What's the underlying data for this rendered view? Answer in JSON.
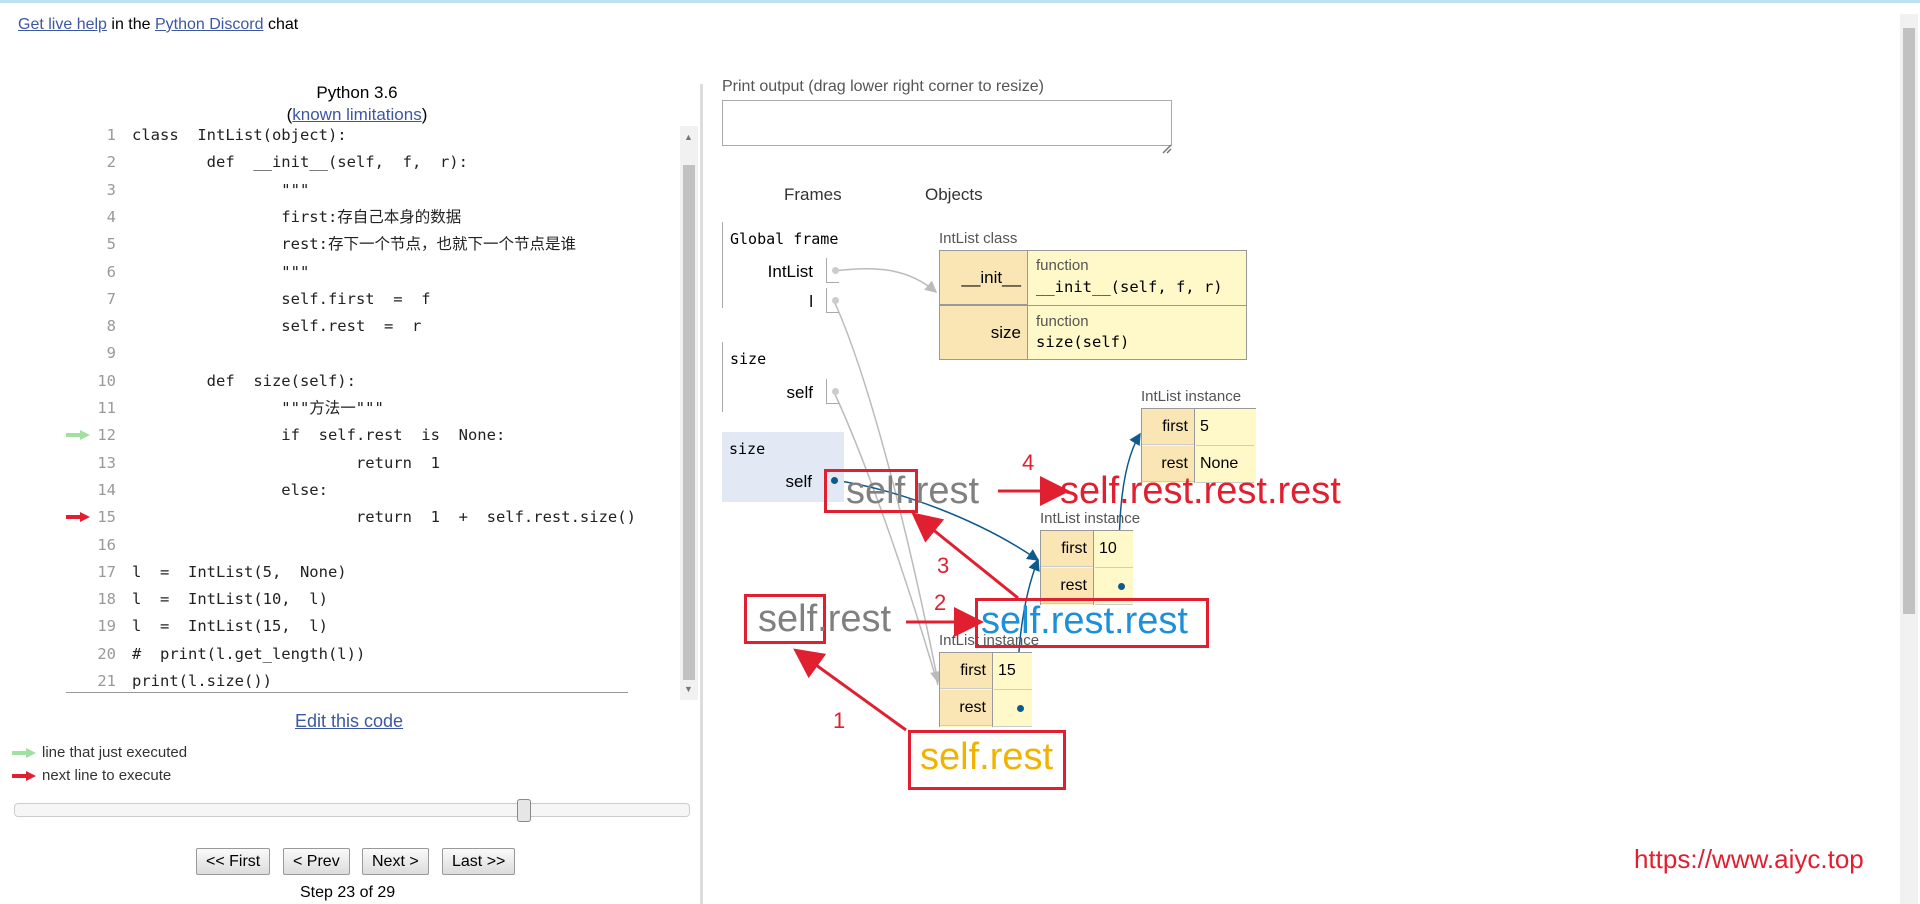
{
  "header": {
    "live_help_link": "Get live help",
    "in_the": "in the",
    "discord_link": "Python Discord",
    "chat": "chat"
  },
  "code": {
    "language": "Python 3.6",
    "limitations_link": "known limitations",
    "lines": [
      {
        "n": "1",
        "text": "class  IntList(object):"
      },
      {
        "n": "2",
        "text": "        def  __init__(self,  f,  r):"
      },
      {
        "n": "3",
        "text": "                \"\"\""
      },
      {
        "n": "4",
        "text": "                first:存自己本身的数据"
      },
      {
        "n": "5",
        "text": "                rest:存下一个节点，也就下一个节点是谁"
      },
      {
        "n": "6",
        "text": "                \"\"\""
      },
      {
        "n": "7",
        "text": "                self.first  =  f"
      },
      {
        "n": "8",
        "text": "                self.rest  =  r"
      },
      {
        "n": "9",
        "text": ""
      },
      {
        "n": "10",
        "text": "        def  size(self):"
      },
      {
        "n": "11",
        "text": "                \"\"\"方法一\"\"\""
      },
      {
        "n": "12",
        "text": "                if  self.rest  is  None:"
      },
      {
        "n": "13",
        "text": "                        return  1"
      },
      {
        "n": "14",
        "text": "                else:"
      },
      {
        "n": "15",
        "text": "                        return  1  +  self.rest.size()"
      },
      {
        "n": "16",
        "text": ""
      },
      {
        "n": "17",
        "text": "l  =  IntList(5,  None)"
      },
      {
        "n": "18",
        "text": "l  =  IntList(10,  l)"
      },
      {
        "n": "19",
        "text": "l  =  IntList(15,  l)"
      },
      {
        "n": "20",
        "text": "#  print(l.get_length(l))"
      },
      {
        "n": "21",
        "text": "print(l.size())"
      }
    ],
    "executed_line": "12",
    "next_line": "15"
  },
  "edit_link": "Edit this code",
  "legend": {
    "executed": "line that just executed",
    "next": "next line to execute",
    "executed_color": "#a0e0a0",
    "next_color": "#e02030"
  },
  "navigation": {
    "first": "<< First",
    "prev": "< Prev",
    "next": "Next >",
    "last": "Last >>",
    "step": "Step 23 of 29",
    "current_step": 23,
    "total_steps": 29
  },
  "print_output": {
    "label": "Print output (drag lower right corner to resize)",
    "value": ""
  },
  "viz": {
    "frames_header": "Frames",
    "objects_header": "Objects",
    "global_frame": {
      "name": "Global frame",
      "vars": [
        "IntList",
        "l"
      ]
    },
    "frames": [
      {
        "name": "size",
        "var": "self"
      },
      {
        "name": "size",
        "var": "self"
      }
    ],
    "class_obj": {
      "label": "IntList class",
      "methods": [
        {
          "name": "__init__",
          "type": "function",
          "sig": "__init__(self,  f,  r)"
        },
        {
          "name": "size",
          "type": "function",
          "sig": "size(self)"
        }
      ]
    },
    "instances": [
      {
        "label": "IntList instance",
        "first": "5",
        "rest": "None"
      },
      {
        "label": "IntList instance",
        "first": "10",
        "rest": ""
      },
      {
        "label": "IntList instance",
        "first": "15",
        "rest": ""
      }
    ],
    "field_names": {
      "first": "first",
      "rest": "rest"
    }
  },
  "annotations": {
    "self_rest_gray_1": "self.rest",
    "self_rest_gray_2": "self.rest",
    "self_rest_rest_rest": "self.rest.rest.rest",
    "self_rest_rest": "self.rest.rest",
    "self_rest_yellow": "self.rest",
    "n1": "1",
    "n2": "2",
    "n3": "3",
    "n4": "4",
    "colors": {
      "red": "#e02030",
      "blue": "#1e90d8",
      "yellow": "#f0b400",
      "gray": "#808080"
    }
  },
  "watermark": "https://www.aiyc.top"
}
